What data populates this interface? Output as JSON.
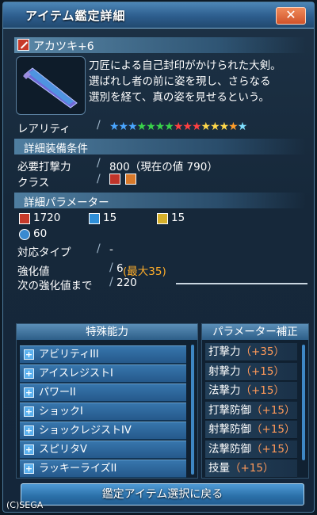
{
  "window": {
    "title": "アイテム鑑定詳細",
    "close_label": "✕"
  },
  "item": {
    "name": "アカツキ+6",
    "description_lines": [
      "刀匠による自己封印がかけられた大剣。",
      "選ばれし者の前に姿を現し、さらなる",
      "選別を経て、真の姿を見せるという。"
    ],
    "icon": "sword-icon"
  },
  "rarity": {
    "label": "レアリティ",
    "stars": 13
  },
  "requirements": {
    "header": "詳細装備条件",
    "attack_label": "必要打撃力",
    "attack_value": "800（現在の値 790）",
    "class_label": "クラス"
  },
  "parameters": {
    "header": "詳細パラメーター",
    "stats": [
      {
        "icon": "strike-attack-icon",
        "value": "1720"
      },
      {
        "icon": "ranged-attack-icon",
        "value": "15"
      },
      {
        "icon": "tech-attack-icon",
        "value": "15"
      },
      {
        "icon": "dexterity-icon",
        "value": "60"
      }
    ],
    "type_label": "対応タイプ",
    "type_value": "-",
    "grind_label": "強化値",
    "grind_value": "6",
    "grind_max": "(最大35)",
    "next_label": "次の強化値まで",
    "next_value": "220",
    "next_progress": 0
  },
  "abilities": {
    "header": "特殊能力",
    "items": [
      "アビリティIII",
      "アイスレジストI",
      "パワーII",
      "ショックI",
      "ショックレジストIV",
      "スピリタV",
      "ラッキーライズII"
    ]
  },
  "param_bonus": {
    "header": "パラメーター補正",
    "items": [
      {
        "name": "打撃力",
        "value": "（+35）"
      },
      {
        "name": "射撃力",
        "value": "（+15）"
      },
      {
        "name": "法撃力",
        "value": "（+15）"
      },
      {
        "name": "打撃防御",
        "value": "（+15）"
      },
      {
        "name": "射撃防御",
        "value": "（+15）"
      },
      {
        "name": "法撃防御",
        "value": "（+15）"
      },
      {
        "name": "技量",
        "value": "（+15）"
      }
    ]
  },
  "footer": {
    "back_label": "鑑定アイテム選択に戻る",
    "copyright": "(C)SEGA"
  },
  "colors": {
    "accent": "#2f6ea6",
    "orange": "#ffae2a",
    "bonus": "#ff9a5a"
  }
}
